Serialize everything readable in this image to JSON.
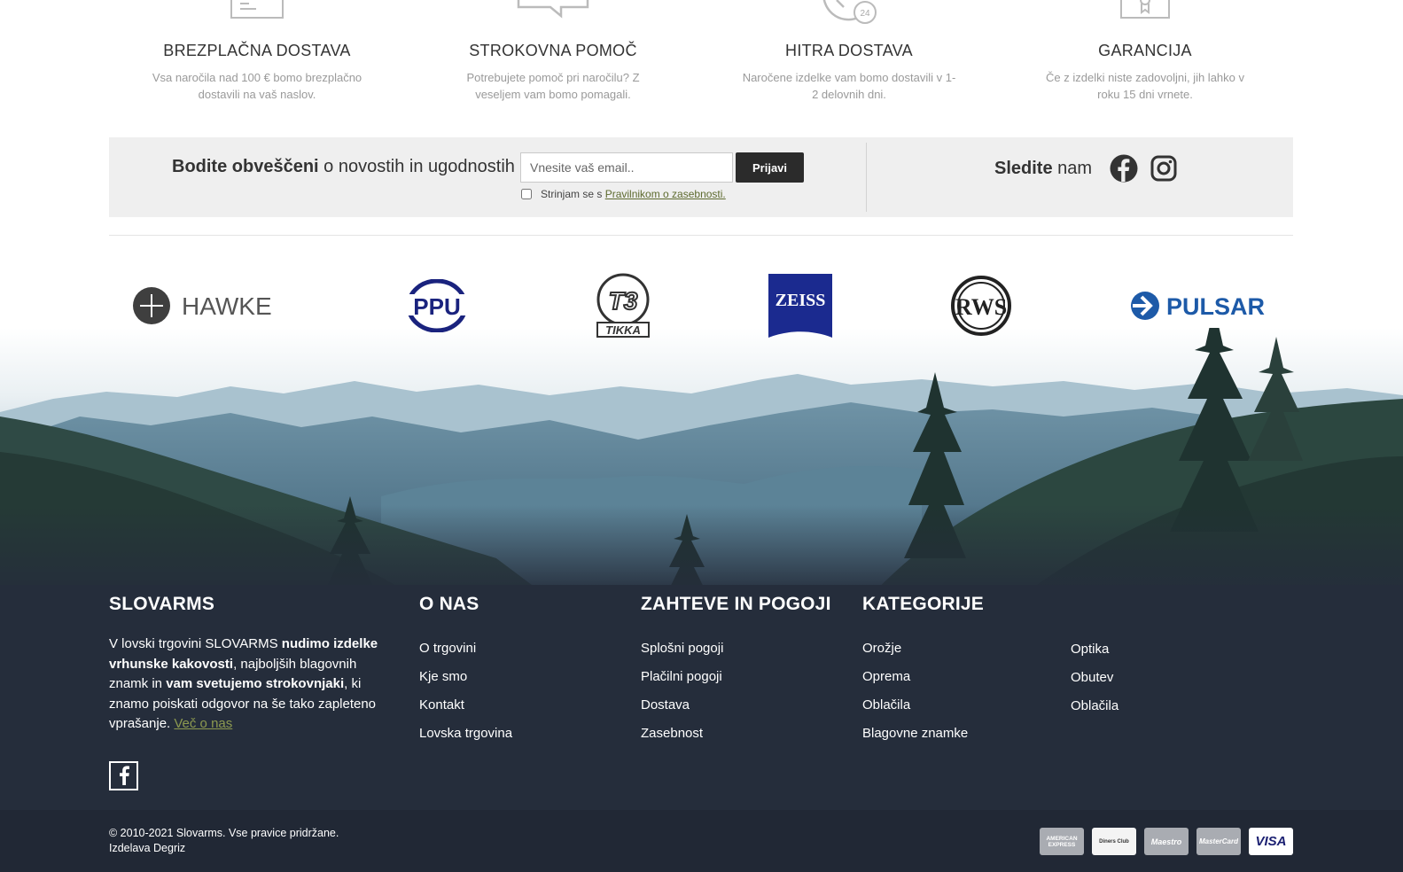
{
  "features": [
    {
      "icon": "document-icon",
      "title": "BREZPLAČNA DOSTAVA",
      "text": "Vsa naročila nad 100 € bomo brezplačno dostavili na vaš naslov."
    },
    {
      "icon": "chat-icon",
      "title": "STROKOVNA POMOČ",
      "text": "Potrebujete pomoč pri naročilu? Z veseljem vam bomo pomagali."
    },
    {
      "icon": "clock-24-icon",
      "title": "HITRA DOSTAVA",
      "text": "Naročene izdelke vam bomo dostavili v 1-2 delovnih dni."
    },
    {
      "icon": "certificate-icon",
      "title": "GARANCIJA",
      "text": "Če z izdelki niste zadovoljni, jih lahko v roku 15 dni vrnete."
    }
  ],
  "newsletter": {
    "title_bold": "Bodite obveščeni",
    "title_rest": " o novostih in ugodnostih",
    "email_placeholder": "Vnesite vaš email..",
    "submit_label": "Prijavi",
    "consent_prefix": "Strinjam se s ",
    "consent_link": "Pravilnikom o zasebnosti."
  },
  "follow": {
    "bold": "Sledite",
    "rest": " nam",
    "icons": [
      "facebook-icon",
      "instagram-icon"
    ]
  },
  "brands": [
    {
      "name": "HAWKE",
      "label": "HAWKE"
    },
    {
      "name": "PPU",
      "label": "PPU"
    },
    {
      "name": "TIKKA",
      "label": "TIKKA"
    },
    {
      "name": "ZEISS",
      "label": "ZEISS"
    },
    {
      "name": "RWS",
      "label": "RWS"
    },
    {
      "name": "PULSAR",
      "label": "PULSAR"
    }
  ],
  "footer": {
    "about": {
      "title": "SLOVARMS",
      "t1": "V lovski trgovini SLOVARMS ",
      "b1": "nudimo izdelke vrhunske kakovosti",
      "t2": ", najboljših blagovnih znamk in ",
      "b2": "vam svetujemo strokovnjaki",
      "t3": ", ki znamo poiskati odgovor na še tako zapleteno vprašanje. ",
      "more": "Več o nas"
    },
    "onas": {
      "title": "O NAS",
      "links": [
        "O trgovini",
        "Kje smo",
        "Kontakt",
        "Lovska trgovina"
      ]
    },
    "pogoji": {
      "title": "ZAHTEVE IN POGOJI",
      "links": [
        "Splošni pogoji",
        "Plačilni pogoji",
        "Dostava",
        "Zasebnost"
      ]
    },
    "kategorije": {
      "title": "KATEGORIJE",
      "links1": [
        "Orožje",
        "Oprema",
        "Oblačila",
        "Blagovne znamke"
      ],
      "links2": [
        "Optika",
        "Obutev",
        "Oblačila"
      ]
    }
  },
  "bottom": {
    "copyright": "© 2010-2021 Slovarms. Vse pravice pridržane.",
    "credit": "Izdelava Degriz",
    "payments": [
      "AMERICAN EXPRESS",
      "Diners Club",
      "Maestro",
      "MasterCard",
      "VISA"
    ]
  },
  "colors": {
    "footer_bg": "#252d3b",
    "bottom_bg": "#212835",
    "link_accent": "#8d9a50",
    "zeiss_blue": "#1b2a8f",
    "pulsar_blue": "#1d5aa8",
    "ppu_navy": "#1a237e"
  }
}
